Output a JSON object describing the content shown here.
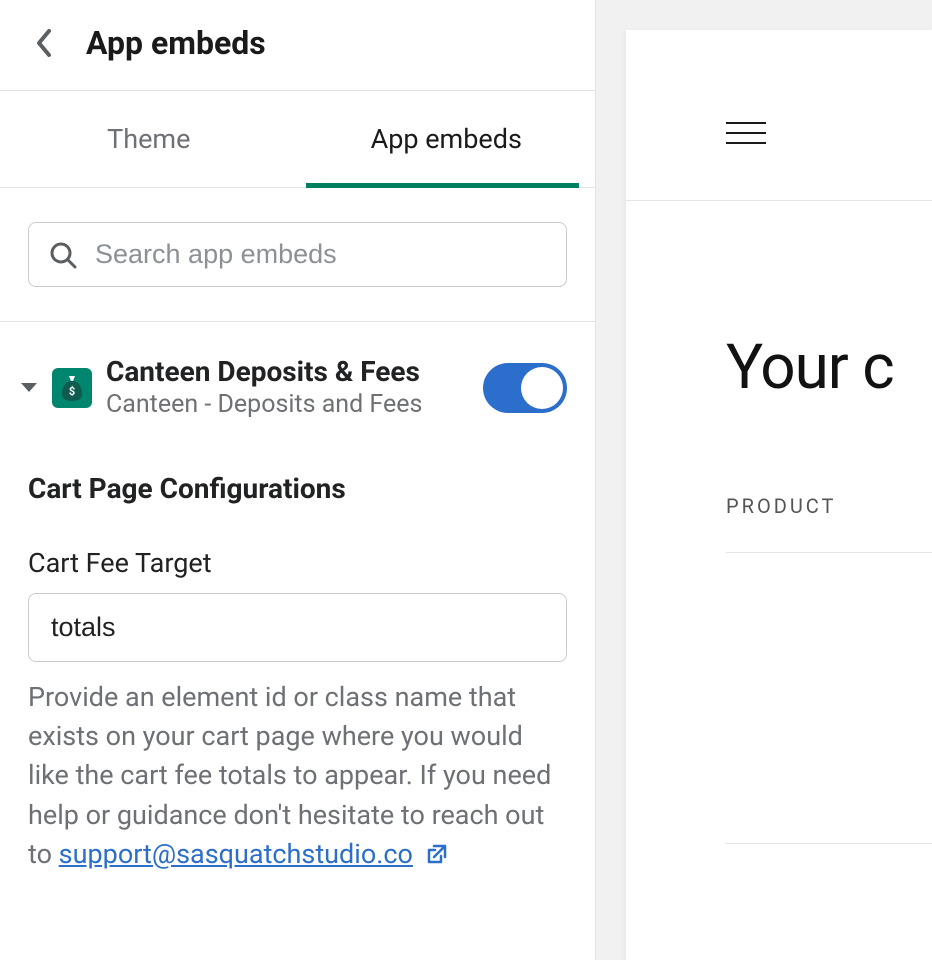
{
  "header": {
    "title": "App embeds"
  },
  "tabs": {
    "theme": "Theme",
    "app_embeds": "App embeds"
  },
  "search": {
    "placeholder": "Search app embeds"
  },
  "embed": {
    "title": "Canteen Deposits & Fees",
    "subtitle": "Canteen - Deposits and Fees",
    "enabled": true,
    "icon": "money-bag-icon"
  },
  "config": {
    "section_title": "Cart Page Configurations",
    "cart_fee_target": {
      "label": "Cart Fee Target",
      "value": "totals",
      "help": "Provide an element id or class name that exists on your cart page where you would like the cart fee totals to appear. If you need help or guidance don't hesitate to reach out to ",
      "support_link": "support@sasquatchstudio.co"
    }
  },
  "preview": {
    "heading": "Your c",
    "column_label": "PRODUCT"
  }
}
